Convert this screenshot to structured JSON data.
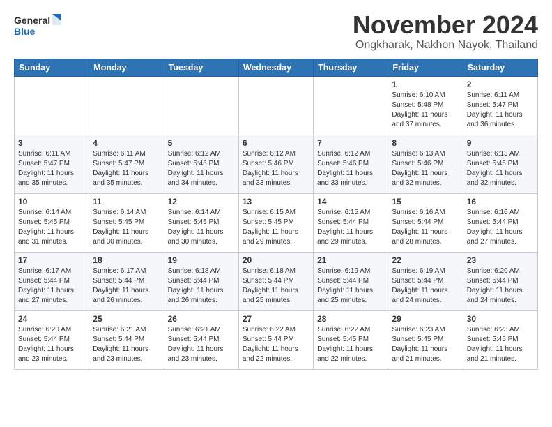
{
  "header": {
    "logo": {
      "general": "General",
      "blue": "Blue"
    },
    "title": "November 2024",
    "location": "Ongkharak, Nakhon Nayok, Thailand"
  },
  "calendar": {
    "days_of_week": [
      "Sunday",
      "Monday",
      "Tuesday",
      "Wednesday",
      "Thursday",
      "Friday",
      "Saturday"
    ],
    "weeks": [
      [
        {
          "day": "",
          "info": ""
        },
        {
          "day": "",
          "info": ""
        },
        {
          "day": "",
          "info": ""
        },
        {
          "day": "",
          "info": ""
        },
        {
          "day": "",
          "info": ""
        },
        {
          "day": "1",
          "info": "Sunrise: 6:10 AM\nSunset: 5:48 PM\nDaylight: 11 hours\nand 37 minutes."
        },
        {
          "day": "2",
          "info": "Sunrise: 6:11 AM\nSunset: 5:47 PM\nDaylight: 11 hours\nand 36 minutes."
        }
      ],
      [
        {
          "day": "3",
          "info": "Sunrise: 6:11 AM\nSunset: 5:47 PM\nDaylight: 11 hours\nand 35 minutes."
        },
        {
          "day": "4",
          "info": "Sunrise: 6:11 AM\nSunset: 5:47 PM\nDaylight: 11 hours\nand 35 minutes."
        },
        {
          "day": "5",
          "info": "Sunrise: 6:12 AM\nSunset: 5:46 PM\nDaylight: 11 hours\nand 34 minutes."
        },
        {
          "day": "6",
          "info": "Sunrise: 6:12 AM\nSunset: 5:46 PM\nDaylight: 11 hours\nand 33 minutes."
        },
        {
          "day": "7",
          "info": "Sunrise: 6:12 AM\nSunset: 5:46 PM\nDaylight: 11 hours\nand 33 minutes."
        },
        {
          "day": "8",
          "info": "Sunrise: 6:13 AM\nSunset: 5:46 PM\nDaylight: 11 hours\nand 32 minutes."
        },
        {
          "day": "9",
          "info": "Sunrise: 6:13 AM\nSunset: 5:45 PM\nDaylight: 11 hours\nand 32 minutes."
        }
      ],
      [
        {
          "day": "10",
          "info": "Sunrise: 6:14 AM\nSunset: 5:45 PM\nDaylight: 11 hours\nand 31 minutes."
        },
        {
          "day": "11",
          "info": "Sunrise: 6:14 AM\nSunset: 5:45 PM\nDaylight: 11 hours\nand 30 minutes."
        },
        {
          "day": "12",
          "info": "Sunrise: 6:14 AM\nSunset: 5:45 PM\nDaylight: 11 hours\nand 30 minutes."
        },
        {
          "day": "13",
          "info": "Sunrise: 6:15 AM\nSunset: 5:45 PM\nDaylight: 11 hours\nand 29 minutes."
        },
        {
          "day": "14",
          "info": "Sunrise: 6:15 AM\nSunset: 5:44 PM\nDaylight: 11 hours\nand 29 minutes."
        },
        {
          "day": "15",
          "info": "Sunrise: 6:16 AM\nSunset: 5:44 PM\nDaylight: 11 hours\nand 28 minutes."
        },
        {
          "day": "16",
          "info": "Sunrise: 6:16 AM\nSunset: 5:44 PM\nDaylight: 11 hours\nand 27 minutes."
        }
      ],
      [
        {
          "day": "17",
          "info": "Sunrise: 6:17 AM\nSunset: 5:44 PM\nDaylight: 11 hours\nand 27 minutes."
        },
        {
          "day": "18",
          "info": "Sunrise: 6:17 AM\nSunset: 5:44 PM\nDaylight: 11 hours\nand 26 minutes."
        },
        {
          "day": "19",
          "info": "Sunrise: 6:18 AM\nSunset: 5:44 PM\nDaylight: 11 hours\nand 26 minutes."
        },
        {
          "day": "20",
          "info": "Sunrise: 6:18 AM\nSunset: 5:44 PM\nDaylight: 11 hours\nand 25 minutes."
        },
        {
          "day": "21",
          "info": "Sunrise: 6:19 AM\nSunset: 5:44 PM\nDaylight: 11 hours\nand 25 minutes."
        },
        {
          "day": "22",
          "info": "Sunrise: 6:19 AM\nSunset: 5:44 PM\nDaylight: 11 hours\nand 24 minutes."
        },
        {
          "day": "23",
          "info": "Sunrise: 6:20 AM\nSunset: 5:44 PM\nDaylight: 11 hours\nand 24 minutes."
        }
      ],
      [
        {
          "day": "24",
          "info": "Sunrise: 6:20 AM\nSunset: 5:44 PM\nDaylight: 11 hours\nand 23 minutes."
        },
        {
          "day": "25",
          "info": "Sunrise: 6:21 AM\nSunset: 5:44 PM\nDaylight: 11 hours\nand 23 minutes."
        },
        {
          "day": "26",
          "info": "Sunrise: 6:21 AM\nSunset: 5:44 PM\nDaylight: 11 hours\nand 23 minutes."
        },
        {
          "day": "27",
          "info": "Sunrise: 6:22 AM\nSunset: 5:44 PM\nDaylight: 11 hours\nand 22 minutes."
        },
        {
          "day": "28",
          "info": "Sunrise: 6:22 AM\nSunset: 5:45 PM\nDaylight: 11 hours\nand 22 minutes."
        },
        {
          "day": "29",
          "info": "Sunrise: 6:23 AM\nSunset: 5:45 PM\nDaylight: 11 hours\nand 21 minutes."
        },
        {
          "day": "30",
          "info": "Sunrise: 6:23 AM\nSunset: 5:45 PM\nDaylight: 11 hours\nand 21 minutes."
        }
      ]
    ]
  }
}
